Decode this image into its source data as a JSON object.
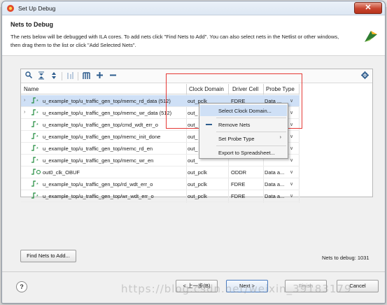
{
  "window": {
    "title": "Set Up Debug",
    "close_glyph": "✕"
  },
  "header": {
    "title": "Nets to Debug",
    "description": "The nets below will be debugged with ILA cores. To add nets click \"Find Nets to Add\". You can also select nets in the Netlist or other windows, then drag them to the list or click \"Add Selected Nets\"."
  },
  "toolbar": {
    "icons": [
      "search-icon",
      "collapse-all-icon",
      "expand-all-icon",
      "sort-icon",
      "columns-icon",
      "add-icon",
      "remove-icon",
      "settings-icon"
    ]
  },
  "table": {
    "columns": [
      "Name",
      "Clock Domain",
      "Driver Cell",
      "Probe Type"
    ],
    "rows": [
      {
        "expand": "›",
        "name": "u_example_top/u_traffic_gen_top/memc_rd_data (512)",
        "clock": "out_pclk",
        "driver": "FDRE",
        "probe": "Data ..."
      },
      {
        "expand": "›",
        "name": "u_example_top/u_traffic_gen_top/memc_wr_data (512)",
        "clock": "out_",
        "driver": "",
        "probe": ""
      },
      {
        "expand": "",
        "name": "u_example_top/u_traffic_gen_top/cmd_wdt_err_o",
        "clock": "out_",
        "driver": "",
        "probe": ""
      },
      {
        "expand": "",
        "name": "u_example_top/u_traffic_gen_top/memc_init_done",
        "clock": "out_",
        "driver": "",
        "probe": ""
      },
      {
        "expand": "",
        "name": "u_example_top/u_traffic_gen_top/memc_rd_en",
        "clock": "out_",
        "driver": "",
        "probe": ""
      },
      {
        "expand": "",
        "name": "u_example_top/u_traffic_gen_top/memc_wr_en",
        "clock": "out_",
        "driver": "",
        "probe": ""
      },
      {
        "expand": "",
        "name": "out0_clk_OBUF",
        "clock": "out_pclk",
        "driver": "ODDR",
        "probe": "Data a..."
      },
      {
        "expand": "",
        "name": "u_example_top/u_traffic_gen_top/rd_wdt_err_o",
        "clock": "out_pclk",
        "driver": "FDRE",
        "probe": "Data a..."
      },
      {
        "expand": "",
        "name": "u_example_top/u_traffic_gen_top/wr_wdt_err_o",
        "clock": "out_pclk",
        "driver": "FDRE",
        "probe": "Data a..."
      }
    ]
  },
  "context_menu": {
    "items": [
      {
        "label": "Select Clock Domain..."
      },
      {
        "label": "Remove Nets"
      },
      {
        "label": "Set Probe Type",
        "submenu": "›"
      },
      {
        "label": "Export to Spreadsheet..."
      }
    ]
  },
  "footer": {
    "find_nets_label": "Find Nets to Add...",
    "nets_count": "Nets to debug: 1031",
    "back_label": "< 上一步(B)",
    "next_label": "Next >",
    "finish_label": "Finish",
    "cancel_label": "Cancel",
    "help_glyph": "?"
  },
  "watermark": "https://blog.csdn.net/weixin_39183179",
  "colors": {
    "accent": "#2e5d8e",
    "selection": "#cfe0f6",
    "highlight_box": "#e53935",
    "net_icon": "#1d8a3b"
  }
}
